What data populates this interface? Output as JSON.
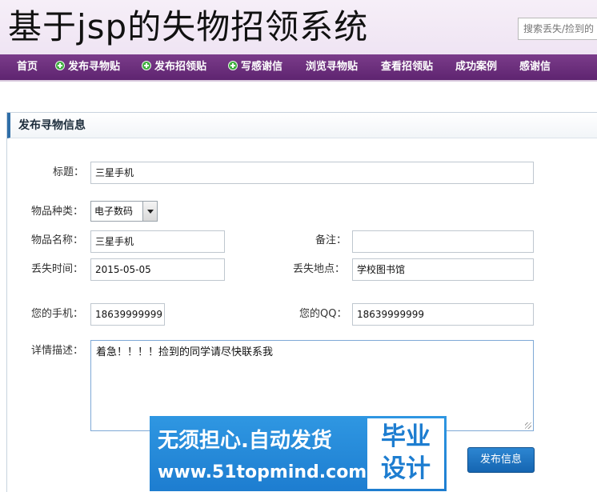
{
  "header": {
    "site_title": "基于jsp的失物招领系统",
    "search_placeholder": "搜索丢失/捡到的"
  },
  "nav": {
    "items": [
      {
        "label": "首页",
        "icon": null
      },
      {
        "label": "发布寻物贴",
        "icon": "plus-icon"
      },
      {
        "label": "发布招领贴",
        "icon": "plus-icon"
      },
      {
        "label": "写感谢信",
        "icon": "plus-icon"
      },
      {
        "label": "浏览寻物贴",
        "icon": null
      },
      {
        "label": "查看招领贴",
        "icon": null
      },
      {
        "label": "成功案例",
        "icon": null
      },
      {
        "label": "感谢信",
        "icon": null
      }
    ]
  },
  "form": {
    "panel_title": "发布寻物信息",
    "title_label": "标题：",
    "title_value": "三星手机",
    "category_label": "物品种类：",
    "category_value": "电子数码",
    "name_label": "物品名称：",
    "name_value": "三星手机",
    "remark_label": "备注：",
    "remark_value": "",
    "time_label": "丢失时间：",
    "time_value": "2015-05-05",
    "place_label": "丢失地点：",
    "place_value": "学校图书馆",
    "phone_label": "您的手机：",
    "phone_value": "18639999999",
    "qq_label": "您的QQ：",
    "qq_value": "18639999999",
    "detail_label": "详情描述：",
    "detail_value": "着急！！！！捡到的同学请尽快联系我",
    "submit_label": "发布信息"
  },
  "watermark": {
    "line1": "无须担心.自动发货",
    "line2": "www.51topmind.com",
    "badge_line1": "毕业",
    "badge_line2": "设计"
  },
  "colors": {
    "nav_bg": "#6a2c7c",
    "header_bg": "#f2e9f5",
    "accent_blue": "#1d7dd0",
    "panel_border": "#2f6ea7"
  }
}
